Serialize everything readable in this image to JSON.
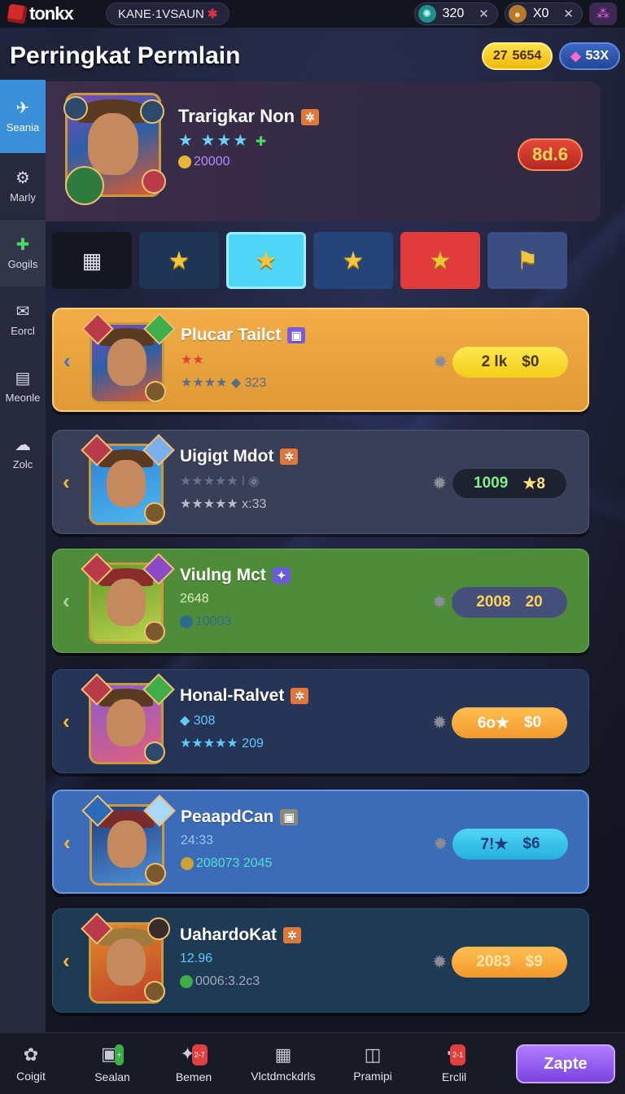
{
  "topbar": {
    "logo_text": "tonkx",
    "server": "KANE·1VSAUN",
    "server_mark": "✱",
    "resources": [
      {
        "icon": "gear-gem-icon",
        "value": "320",
        "close": "✕"
      },
      {
        "icon": "pouch-icon",
        "value": "X0",
        "close": "✕"
      }
    ],
    "menu_icon": "⁂"
  },
  "header": {
    "title": "Perringkat Permlain",
    "gold": "5654",
    "gold_icon": "27",
    "gems": "53X"
  },
  "sidebar": {
    "items": [
      {
        "label": "Seania",
        "icon": "✈"
      },
      {
        "label": "Marly",
        "icon": "⚙"
      },
      {
        "label": "Gogils",
        "icon": "✚"
      },
      {
        "label": "Eorcl",
        "icon": "✉"
      },
      {
        "label": "Meonle",
        "icon": "▤"
      },
      {
        "label": "Zolc",
        "icon": "☁"
      }
    ]
  },
  "profile": {
    "name": "Trarigkar Non",
    "tag": "✲",
    "stars": "★ ★★★",
    "stars_icon": "✚",
    "points": "20000",
    "score": "8d.6"
  },
  "tabs": [
    "grid-icon",
    "star-icon",
    "star-icon",
    "star-flag-icon",
    "star-icon",
    "flag-icon"
  ],
  "tab_glyphs": [
    "▦",
    "★",
    "★",
    "★",
    "★",
    "⚑"
  ],
  "players": [
    {
      "name": "Plucar Tailct",
      "tag": "▣",
      "line1": "★★",
      "line2": "★★★★ ◆ 323",
      "pill_left": "2 lk",
      "pill_right": "$0",
      "chev": "‹",
      "theme": "orange"
    },
    {
      "name": "Uigigt Mdot",
      "tag": "✲",
      "line1": "★★★★★ l ◉",
      "line2": "★★★★★ x:33",
      "pill_left": "1009",
      "pill_right": "★8",
      "chev": "‹",
      "theme": "slate"
    },
    {
      "name": "Viulng Mct",
      "tag": "✦",
      "line1": "2648",
      "line2": "10003",
      "pill_left": "2008",
      "pill_right": "20",
      "chev": "‹",
      "theme": "green"
    },
    {
      "name": "Honal-Ralvet",
      "tag": "✲",
      "line1": "◆ 308",
      "line2": "★★★★★ 209",
      "pill_left": "6o★",
      "pill_right": "$0",
      "chev": "‹",
      "theme": "navy"
    },
    {
      "name": "PeaapdCan",
      "tag": "▣",
      "line1": "24:33",
      "line2": "208073 2045",
      "pill_left": "7!★",
      "pill_right": "$6",
      "chev": "‹",
      "theme": "blue"
    },
    {
      "name": "UahardoKat",
      "tag": "✲",
      "line1": "12.96",
      "line2": "0006:3.2c3",
      "pill_left": "2083",
      "pill_right": "$9",
      "chev": "‹",
      "theme": "teal"
    }
  ],
  "bottom_nav": [
    {
      "label": "Coigit",
      "icon": "✿",
      "badge": ""
    },
    {
      "label": "Sealan",
      "icon": "▣",
      "badge": "+"
    },
    {
      "label": "Bemen",
      "icon": "✦",
      "badge": "2-7"
    },
    {
      "label": "Vlctdmckdrls",
      "icon": "▦",
      "badge": ""
    },
    {
      "label": "Pramipi",
      "icon": "◫",
      "badge": ""
    },
    {
      "label": "Erclil",
      "icon": "◔",
      "badge": "2-1"
    }
  ],
  "cta": "Zapte",
  "colors": {
    "accent_blue": "#3a8fd9",
    "cta_purple": "#8b55ea",
    "gold": "#f3cd19"
  }
}
